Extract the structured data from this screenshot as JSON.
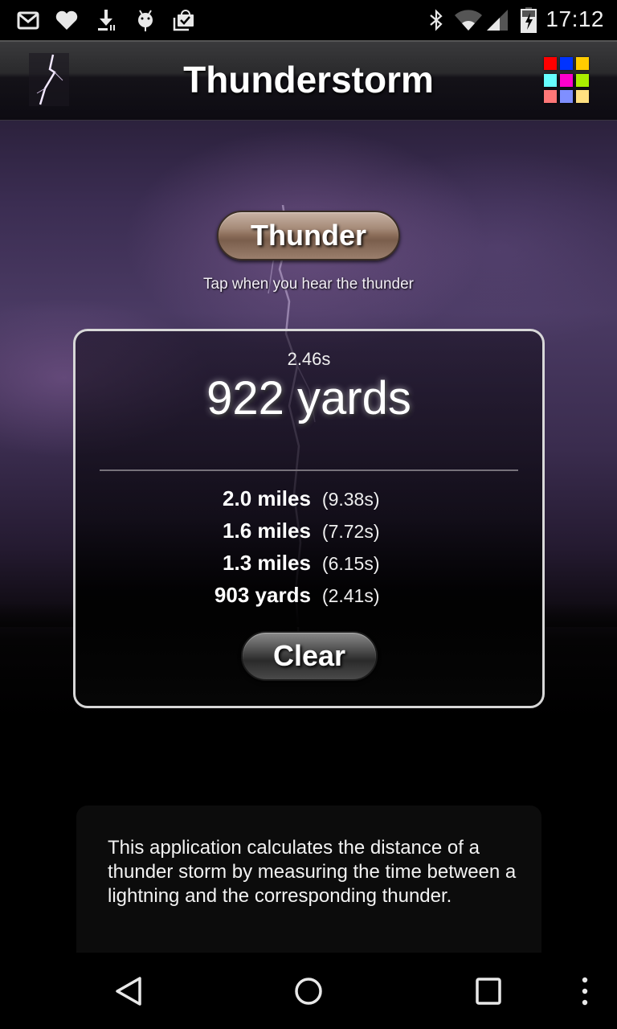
{
  "status_bar": {
    "left_icons": [
      "gmail-icon",
      "heart-icon",
      "download-icon",
      "android-debug-icon",
      "shopping-bag-check-icon"
    ],
    "right_icons": [
      "bluetooth-icon",
      "wifi-icon",
      "cell-signal-icon",
      "battery-charging-icon"
    ],
    "time": "17:12"
  },
  "action_bar": {
    "title": "Thunderstorm",
    "app_icon": "lightning-icon",
    "menu_icon": "color-grid-icon",
    "menu_colors": [
      "#ff0000",
      "#0033ff",
      "#ffcc00",
      "#66ffff",
      "#ff00cc",
      "#aaee00",
      "#ff7777",
      "#7f8fff",
      "#ffe080"
    ]
  },
  "main": {
    "thunder_button": "Thunder",
    "tap_hint": "Tap when you hear the thunder",
    "result": {
      "elapsed": "2.46s",
      "distance": "922 yards"
    },
    "history": [
      {
        "distance": "2.0 miles",
        "time": "(9.38s)"
      },
      {
        "distance": "1.6 miles",
        "time": "(7.72s)"
      },
      {
        "distance": "1.3 miles",
        "time": "(6.15s)"
      },
      {
        "distance": "903 yards",
        "time": "(2.41s)"
      }
    ],
    "clear_button": "Clear",
    "info_text": "This application calculates the distance of a thunder storm by measuring the time between a lightning and the corresponding thunder."
  },
  "nav_bar": {
    "buttons": [
      "back-icon",
      "home-icon",
      "recents-icon",
      "overflow-menu-icon"
    ]
  }
}
